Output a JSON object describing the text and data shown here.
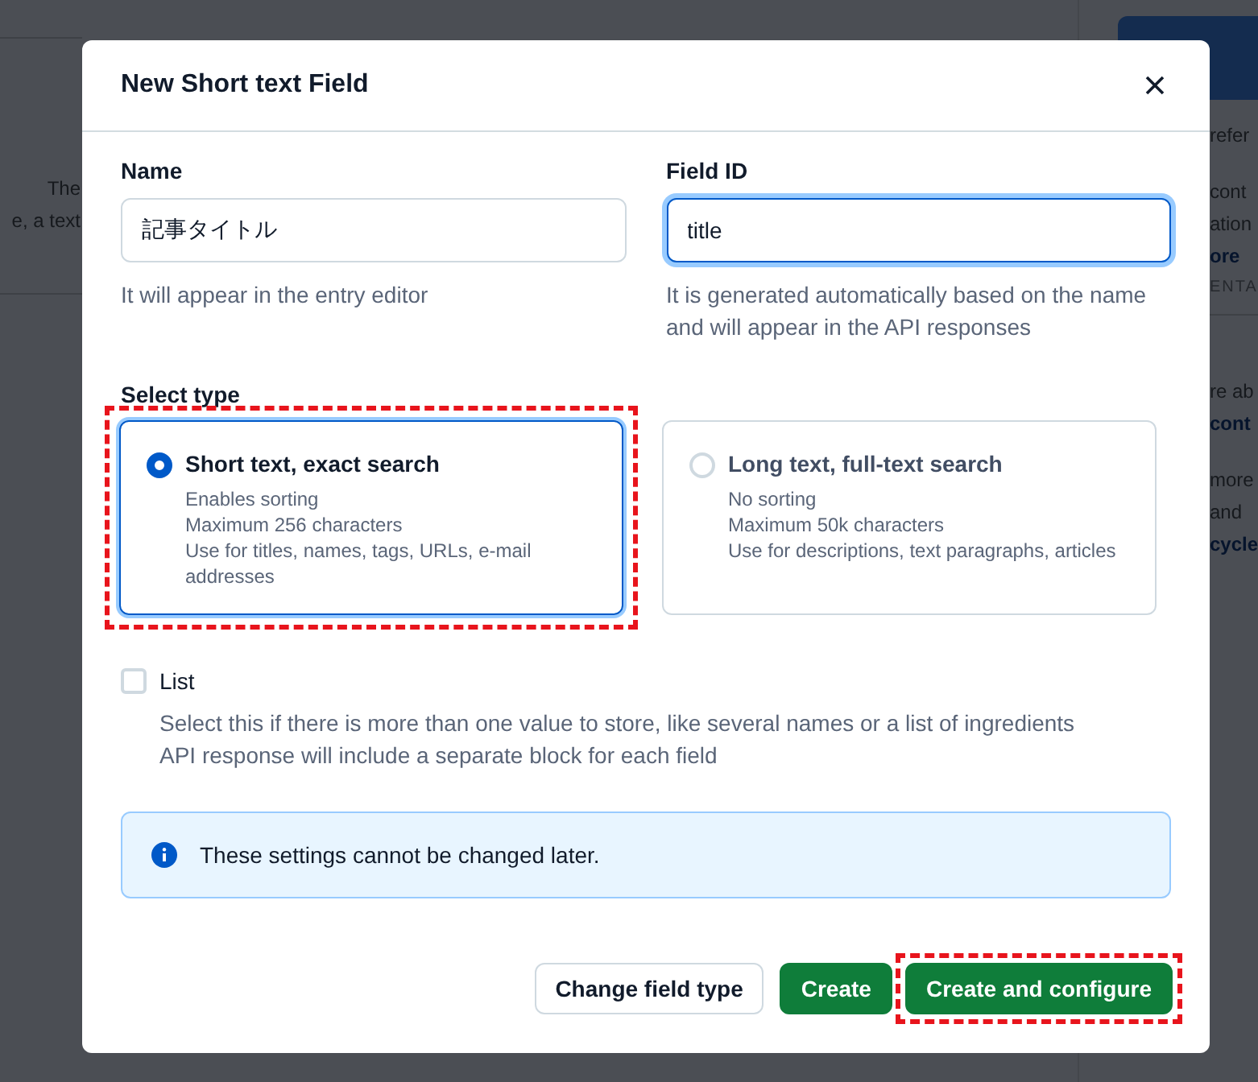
{
  "background": {
    "left_texts": [
      "The",
      "e, a text"
    ],
    "right_texts": [
      {
        "text": "refer",
        "kind": "text"
      },
      {
        "text": "cont",
        "kind": "text"
      },
      {
        "text": "ation",
        "kind": "text"
      },
      {
        "text": "ore",
        "kind": "link"
      },
      {
        "text": "ENTA",
        "kind": "heading"
      },
      {
        "text": "re ab",
        "kind": "text"
      },
      {
        "text": "cont",
        "kind": "link"
      },
      {
        "text": "more",
        "kind": "text"
      },
      {
        "text": "and",
        "kind": "text"
      },
      {
        "text": "cycle",
        "kind": "link"
      }
    ]
  },
  "dialog": {
    "title": "New Short text Field",
    "fields": [
      {
        "label": "Name",
        "value": "記事タイトル",
        "focused": false,
        "help": "It will appear in the entry editor"
      },
      {
        "label": "Field ID",
        "value": "title",
        "focused": true,
        "help": "It is generated automatically based on the name and will appear in the API responses"
      }
    ],
    "select_type": {
      "label": "Select type",
      "options": [
        {
          "title": "Short text, exact search",
          "lines": [
            "Enables sorting",
            "Maximum 256 characters",
            "Use for titles, names, tags, URLs, e-mail addresses"
          ],
          "selected": true,
          "highlighted": true
        },
        {
          "title": "Long text, full-text search",
          "lines": [
            "No sorting",
            "Maximum 50k characters",
            "Use for descriptions, text paragraphs, articles"
          ],
          "selected": false,
          "highlighted": false
        }
      ]
    },
    "list": {
      "label": "List",
      "checked": false,
      "description": [
        "Select this if there is more than one value to store, like several names or a list of ingredients",
        "API response will include a separate block for each field"
      ]
    },
    "note": "These settings cannot be changed later.",
    "buttons": [
      {
        "label": "Change field type",
        "kind": "secondary",
        "highlighted": false
      },
      {
        "label": "Create",
        "kind": "primary",
        "highlighted": false
      },
      {
        "label": "Create and configure",
        "kind": "primary",
        "highlighted": true
      }
    ]
  }
}
